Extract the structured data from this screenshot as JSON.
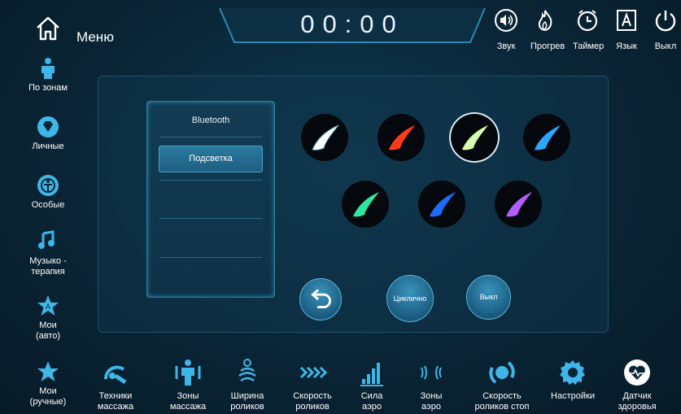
{
  "header": {
    "menu_label": "Меню",
    "timer": "00:00",
    "icons": [
      {
        "label": "Звук",
        "icon": "sound-icon"
      },
      {
        "label": "Прогрев",
        "icon": "heat-icon"
      },
      {
        "label": "Таймер",
        "icon": "timer-icon"
      },
      {
        "label": "Язык",
        "icon": "language-icon"
      },
      {
        "label": "Выкл",
        "icon": "power-icon"
      }
    ]
  },
  "sidebar": {
    "items": [
      {
        "label": "По зонам",
        "icon": "body-zones-icon"
      },
      {
        "label": "Личные",
        "icon": "diamond-icon"
      },
      {
        "label": "Особые",
        "icon": "special-icon"
      },
      {
        "label_line1": "Музыко -",
        "label_line2": "терапия",
        "icon": "music-note-icon"
      },
      {
        "label_line1": "Мои",
        "label_line2": "(авто)",
        "icon": "star-a-icon"
      },
      {
        "label_line1": "Мои",
        "label_line2": "(ручные)",
        "icon": "star-icon"
      }
    ]
  },
  "panel": {
    "bluetooth_label": "Bluetooth",
    "selected_item": "Подсветка",
    "cycle_label": "Циклично",
    "off_label": "Выкл"
  },
  "colors": [
    {
      "name": "white",
      "hex": "#ffffff",
      "selected": false
    },
    {
      "name": "red",
      "hex": "#ff3a1a",
      "selected": false
    },
    {
      "name": "white-green",
      "hex": "#d7ffb0",
      "selected": true
    },
    {
      "name": "blue",
      "hex": "#2aa8ff",
      "selected": false
    },
    {
      "name": "green",
      "hex": "#2ee6a0",
      "selected": false
    },
    {
      "name": "deep-blue",
      "hex": "#1e6cff",
      "selected": false
    },
    {
      "name": "purple",
      "hex": "#b35cff",
      "selected": false
    }
  ],
  "bottom": {
    "items": [
      {
        "line1": "Техники",
        "line2": "массажа",
        "icon": "massage-technique-icon"
      },
      {
        "line1": "Зоны",
        "line2": "массажа",
        "icon": "massage-zones-icon"
      },
      {
        "line1": "Ширина",
        "line2": "роликов",
        "icon": "roller-width-icon"
      },
      {
        "line1": "Скорость",
        "line2": "роликов",
        "icon": "roller-speed-icon"
      },
      {
        "line1": "Сила",
        "line2": "аэро",
        "icon": "air-strength-icon"
      },
      {
        "line1": "Зоны",
        "line2": "аэро",
        "icon": "air-zones-icon"
      },
      {
        "line1": "Скорость",
        "line2": "роликов стоп",
        "icon": "foot-roller-speed-icon"
      },
      {
        "line1": "Настройки",
        "line2": "",
        "icon": "gear-icon"
      },
      {
        "line1": "Датчик",
        "line2": "здоровья",
        "icon": "health-sensor-icon"
      }
    ]
  }
}
